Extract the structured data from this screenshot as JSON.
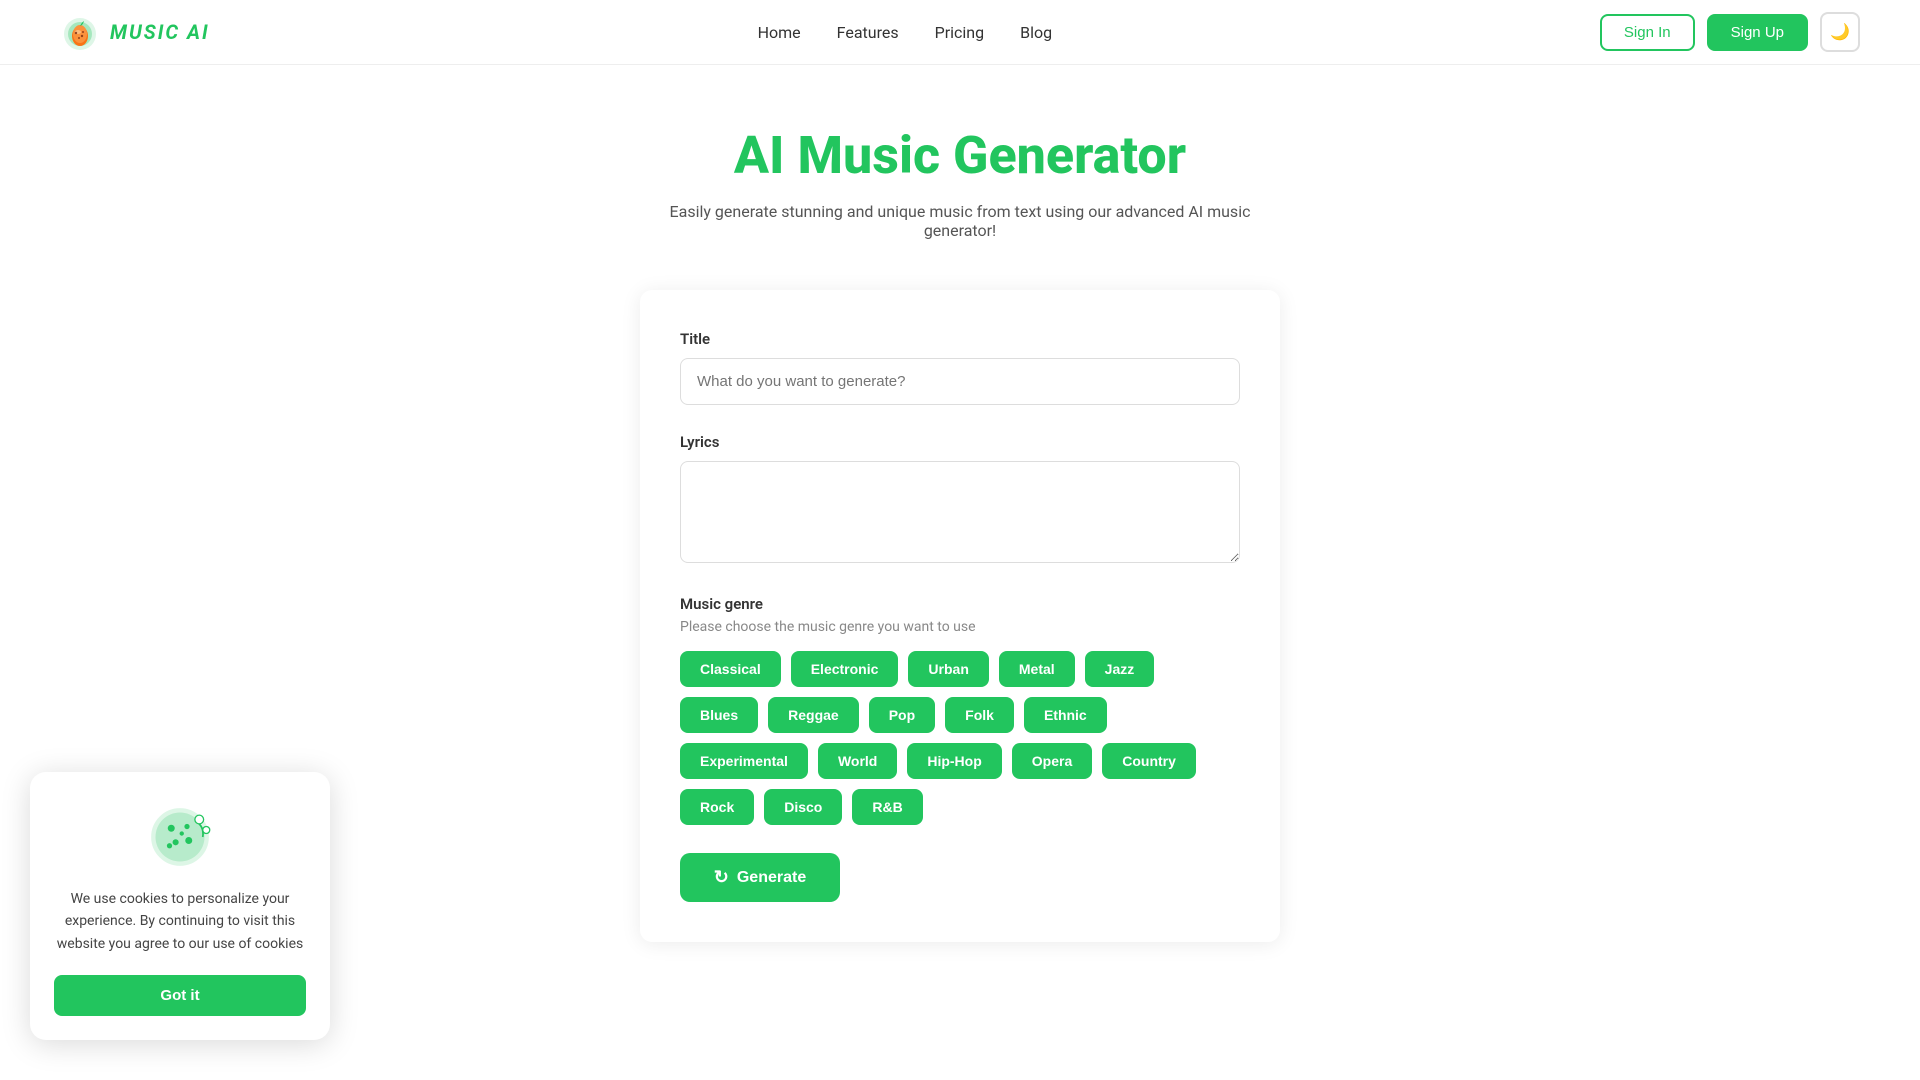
{
  "navbar": {
    "logo_text": "MUSIC AI",
    "nav_links": [
      {
        "label": "Home",
        "id": "home"
      },
      {
        "label": "Features",
        "id": "features"
      },
      {
        "label": "Pricing",
        "id": "pricing"
      },
      {
        "label": "Blog",
        "id": "blog"
      }
    ],
    "signin_label": "Sign In",
    "signup_label": "Sign Up",
    "theme_icon": "🌙"
  },
  "hero": {
    "title": "AI Music Generator",
    "subtitle": "Easily generate stunning and unique music from text using our advanced AI music generator!"
  },
  "form": {
    "title_label": "Title",
    "title_placeholder": "What do you want to generate?",
    "lyrics_label": "Lyrics",
    "lyrics_placeholder": "",
    "genre_label": "Music genre",
    "genre_hint": "Please choose the music genre you want to use",
    "genres": [
      "Classical",
      "Electronic",
      "Urban",
      "Metal",
      "Jazz",
      "Blues",
      "Reggae",
      "Pop",
      "Folk",
      "Ethnic",
      "Experimental",
      "World",
      "Hip-Hop",
      "Opera",
      "Country",
      "Rock",
      "Disco",
      "R&B"
    ],
    "generate_label": "Generate"
  },
  "cookie": {
    "text": "We use cookies to personalize your experience. By continuing to visit this website you agree to our use of cookies",
    "button_label": "Got it"
  }
}
